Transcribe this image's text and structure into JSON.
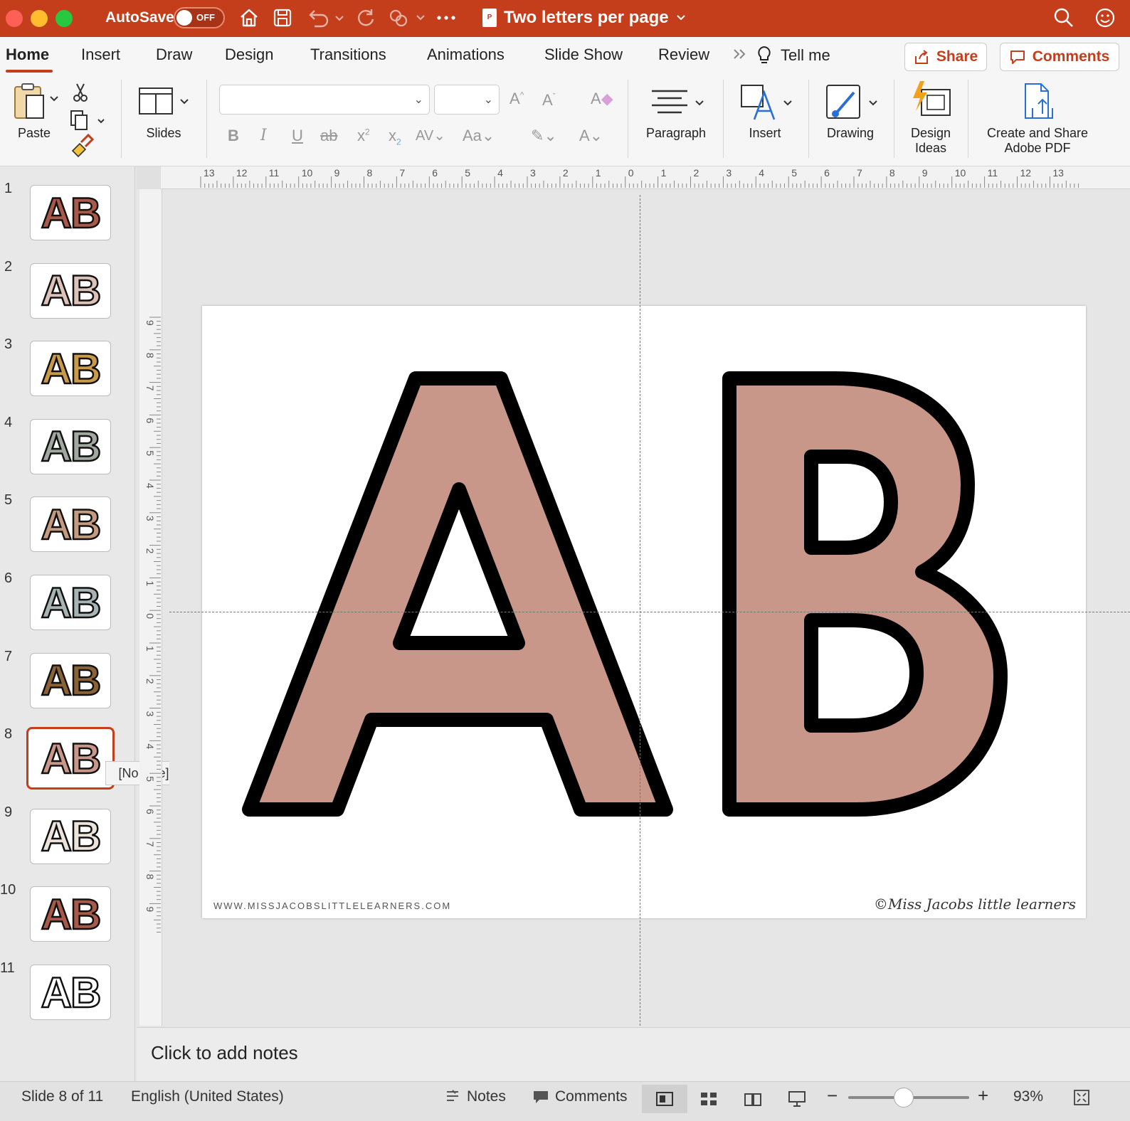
{
  "titlebar": {
    "autosave_label": "AutoSave",
    "autosave_state": "OFF",
    "doc_title": "Two letters per page",
    "accent_color": "#c43e1c"
  },
  "tabs": [
    {
      "label": "Home"
    },
    {
      "label": "Insert"
    },
    {
      "label": "Draw"
    },
    {
      "label": "Design"
    },
    {
      "label": "Transitions"
    },
    {
      "label": "Animations"
    },
    {
      "label": "Slide Show"
    },
    {
      "label": "Review"
    }
  ],
  "tellme": "Tell me",
  "share_label": "Share",
  "comments_label": "Comments",
  "ribbon": {
    "paste": "Paste",
    "slides": "Slides",
    "paragraph": "Paragraph",
    "insert": "Insert",
    "drawing": "Drawing",
    "design_ideas_1": "Design",
    "design_ideas_2": "Ideas",
    "adobe_1": "Create and Share",
    "adobe_2": "Adobe PDF",
    "font_name": "",
    "font_size": ""
  },
  "ruler": {
    "h_labels": [
      "13",
      "12",
      "11",
      "10",
      "9",
      "8",
      "7",
      "6",
      "5",
      "4",
      "3",
      "2",
      "1",
      "0",
      "1",
      "2",
      "3",
      "4",
      "5",
      "6",
      "7",
      "8",
      "9",
      "10",
      "11",
      "12",
      "13"
    ],
    "v_labels": [
      "9",
      "8",
      "7",
      "6",
      "5",
      "4",
      "3",
      "2",
      "1",
      "0",
      "1",
      "2",
      "3",
      "4",
      "5",
      "6",
      "7",
      "8",
      "9"
    ]
  },
  "thumbnails": [
    {
      "num": "1",
      "text": "AB",
      "color": "#a85a4a"
    },
    {
      "num": "2",
      "text": "AB",
      "color": "#dcc2b8"
    },
    {
      "num": "3",
      "text": "AB",
      "color": "#c99a4a"
    },
    {
      "num": "4",
      "text": "AB",
      "color": "#a0a8a0"
    },
    {
      "num": "5",
      "text": "AB",
      "color": "#c49a80"
    },
    {
      "num": "6",
      "text": "AB",
      "color": "#a8b4b4"
    },
    {
      "num": "7",
      "text": "AB",
      "color": "#8a6236"
    },
    {
      "num": "8",
      "text": "AB",
      "color": "#c9978a"
    },
    {
      "num": "9",
      "text": "AB",
      "color": "#ece4da"
    },
    {
      "num": "10",
      "text": "AB",
      "color": "#a85a4a"
    },
    {
      "num": "11",
      "text": "AB",
      "color": "#ffffff"
    }
  ],
  "tooltip": "[No Title]",
  "slide": {
    "letter_fill": "#c9978a",
    "footer_url": "WWW.MISSJACOBSLITTLELEARNERS.COM",
    "footer_copyright": "©Miss Jacobs little learners"
  },
  "notes_placeholder": "Click to add notes",
  "status": {
    "slide_info": "Slide 8 of 11",
    "language": "English (United States)",
    "notes": "Notes",
    "comments": "Comments",
    "zoom": "93%"
  }
}
